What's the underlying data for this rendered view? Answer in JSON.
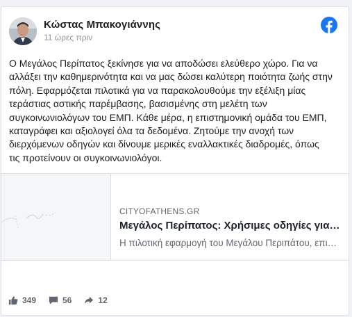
{
  "post": {
    "author": "Κώστας Μπακογιάννης",
    "timestamp": "11 ώρες πριν",
    "text": "Ο Μεγάλος Περίπατος ξεκίνησε για να αποδώσει ελεύθερο χώρο. Για να\nαλλάξει την καθημερινότητα και να μας δώσει καλύτερη ποιότητα ζωής στην\nπόλη. Εφαρμόζεται πιλοτικά για να παρακολουθούμε την εξέλιξη μίας\nτεράστιας αστικής παρέμβασης, βασισμένης στη μελέτη των\nσυγκοινωνιολόγων του ΕΜΠ. Κάθε μέρα, η επιστημονική ομάδα του ΕΜΠ,\nκαταγράφει και αξιολογεί όλα τα δεδομένα. Ζητούμε την ανοχή των\nδιερχόμενων οδηγών και δίνουμε μερικές εναλλακτικές διαδρομές, όπως\nτις προτείνουν οι συγκοινωνιολόγοι.",
    "platform_icon": "facebook-icon"
  },
  "link_preview": {
    "domain": "CITYOFATHENS.GR",
    "title": "Μεγάλος Περίπατος: Χρήσιμες οδηγίες για τους οδηγούς",
    "description": "Η πιλοτική εφαρμογή του Μεγάλου Περιπάτου, επιστημονικά τεκμηριωμένη"
  },
  "stats": {
    "likes": "349",
    "comments": "56",
    "shares": "12"
  },
  "colors": {
    "facebook_blue": "#1877f2",
    "text_primary": "#1c1e21",
    "text_secondary": "#606770"
  }
}
